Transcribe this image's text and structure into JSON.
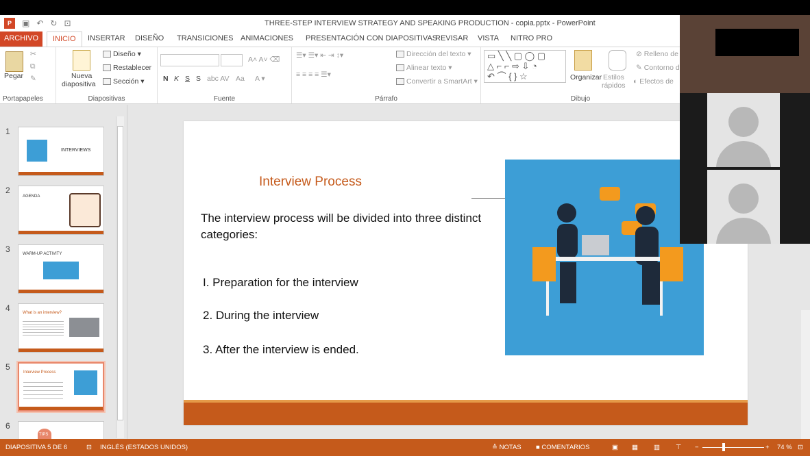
{
  "window": {
    "title": "THREE-STEP INTERVIEW STRATEGY AND SPEAKING PRODUCTION - copia.pptx - PowerPoint"
  },
  "tabs": [
    "ARCHIVO",
    "INICIO",
    "INSERTAR",
    "DISEÑO",
    "TRANSICIONES",
    "ANIMACIONES",
    "PRESENTACIÓN CON DIAPOSITIVAS",
    "REVISAR",
    "VISTA",
    "NITRO PRO"
  ],
  "ribbon": {
    "portapapeles": {
      "pegar": "Pegar",
      "label": "Portapapeles"
    },
    "diapositivas": {
      "nueva": "Nueva",
      "nueva2": "diapositiva",
      "diseno": "Diseño",
      "restablecer": "Restablecer",
      "seccion": "Sección",
      "label": "Diapositivas"
    },
    "fuente": {
      "bold": "N",
      "italic": "K",
      "underline": "S",
      "strike": "S",
      "label": "Fuente",
      "aa": "Aa"
    },
    "parrafo": {
      "direccion": "Dirección del texto",
      "alinear": "Alinear texto",
      "smartart": "Convertir a SmartArt",
      "label": "Párrafo"
    },
    "dibujo": {
      "organizar": "Organizar",
      "estilos": "Estilos",
      "rapidos": "rápidos",
      "relleno": "Relleno de",
      "contorno": "Contorno d",
      "efectos": "Efectos de",
      "label": "Dibujo"
    }
  },
  "thumbnails": [
    {
      "num": "1",
      "title": "INTERVIEWS"
    },
    {
      "num": "2",
      "title": "AGENDA"
    },
    {
      "num": "3",
      "title": "WARM-UP ACTIVITY"
    },
    {
      "num": "4",
      "title": "What is an interview?"
    },
    {
      "num": "5",
      "title": "Interview Process"
    },
    {
      "num": "6",
      "title": "TIPS"
    }
  ],
  "slide": {
    "title": "Interview Process",
    "intro": "The interview process will be divided into three distinct categories:",
    "items": [
      "I.   Preparation for the interview",
      "2.  During the interview",
      "3.  After the interview is ended."
    ]
  },
  "status": {
    "slide": "DIAPOSITIVA 5 DE 6",
    "language": "INGLÉS (ESTADOS UNIDOS)",
    "notas": "NOTAS",
    "comentarios": "COMENTARIOS",
    "zoom": "74 %",
    "zoom_level": 0.74
  },
  "colors": {
    "accent": "#d24726",
    "slide_accent": "#c55a1b",
    "image_bg": "#3d9ed6"
  }
}
